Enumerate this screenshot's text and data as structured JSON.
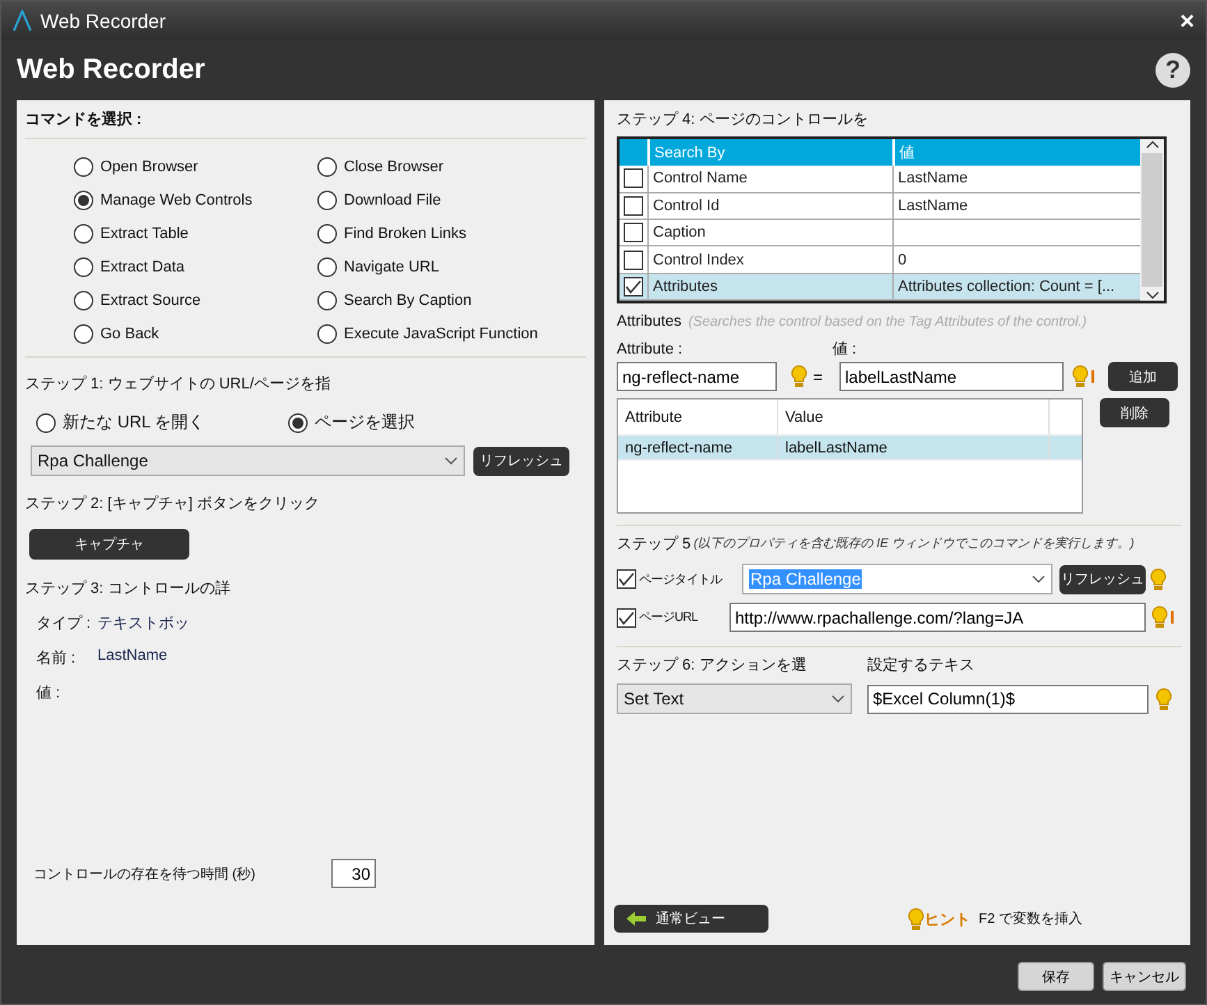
{
  "window": {
    "title": "Web Recorder",
    "close": "×"
  },
  "header": {
    "title": "Web Recorder",
    "help": "?"
  },
  "commands": {
    "label": "コマンドを選択 :",
    "options": [
      {
        "label": "Open Browser",
        "selected": false
      },
      {
        "label": "Close Browser",
        "selected": false
      },
      {
        "label": "Manage Web Controls",
        "selected": true
      },
      {
        "label": "Download File",
        "selected": false
      },
      {
        "label": "Extract Table",
        "selected": false
      },
      {
        "label": "Find Broken Links",
        "selected": false
      },
      {
        "label": "Extract Data",
        "selected": false
      },
      {
        "label": "Navigate URL",
        "selected": false
      },
      {
        "label": "Extract Source",
        "selected": false
      },
      {
        "label": "Search By Caption",
        "selected": false
      },
      {
        "label": "Go Back",
        "selected": false
      },
      {
        "label": "Execute JavaScript Function",
        "selected": false
      }
    ]
  },
  "step1": {
    "label": "ステップ 1: ウェブサイトの URL/ページを指",
    "modes": [
      {
        "label": "新たな URL を開く",
        "selected": false
      },
      {
        "label": "ページを選択",
        "selected": true
      }
    ],
    "page": "Rpa Challenge",
    "refresh": "リフレッシュ"
  },
  "step2": {
    "label": "ステップ 2: [キャプチャ] ボタンをクリック",
    "capture": "キャプチャ"
  },
  "step3": {
    "label": "ステップ 3: コントロールの詳",
    "details": [
      {
        "label": "タイプ :",
        "value": "テキストボッ"
      },
      {
        "label": "名前 :",
        "value": "LastName"
      },
      {
        "label": "値 :"
      }
    ]
  },
  "wait": {
    "label": "コントロールの存在を待つ時間 (秒)",
    "value": "30"
  },
  "step4": {
    "label": "ステップ 4: ページのコントロールを",
    "columns": [
      "Search By",
      "値"
    ],
    "rows": [
      {
        "checked": false,
        "name": "Control Name",
        "value": "LastName",
        "selected": false
      },
      {
        "checked": false,
        "name": "Control Id",
        "value": "LastName",
        "selected": false
      },
      {
        "checked": false,
        "name": "Caption",
        "selected": false
      },
      {
        "checked": false,
        "name": "Control Index",
        "value": "0",
        "selected": false
      },
      {
        "checked": true,
        "name": "Attributes",
        "value": "Attributes collection: Count = [...",
        "selected": true
      }
    ]
  },
  "attributes": {
    "title": "Attributes",
    "hint": "(Searches the control based on the Tag Attributes of the control.)",
    "attribute_label": "Attribute :",
    "value_label": "値 :",
    "attribute": "ng-reflect-name",
    "equals": "=",
    "value": "labelLastName",
    "value_alert": true,
    "add": "追加",
    "delete": "削除",
    "columns": [
      "Attribute",
      "Value"
    ],
    "rows": [
      {
        "attribute": "ng-reflect-name",
        "value": "labelLastName",
        "selected": true
      }
    ]
  },
  "step5": {
    "label": "ステップ 5",
    "note": "(以下のプロパティを含む既存の IE ウィンドウでこのコマンドを実行します。)",
    "title": {
      "label": "ページタイトル",
      "checked": true,
      "value": "Rpa Challenge",
      "highlighted": true,
      "alert": false
    },
    "refresh": "リフレッシュ",
    "url": {
      "label": "ページURL",
      "checked": true,
      "value": "http://www.rpachallenge.com/?lang=JA",
      "alert": true
    }
  },
  "step6": {
    "label": "ステップ 6: アクションを選",
    "action": "Set Text",
    "text_label": "設定するテキス",
    "text": "$Excel Column(1)$",
    "alert": false
  },
  "footer": {
    "back": "通常ビュー",
    "hint_label": "ヒント",
    "hint": "F2 で変数を挿入"
  },
  "buttons": [
    "保存",
    "キャンセル"
  ]
}
